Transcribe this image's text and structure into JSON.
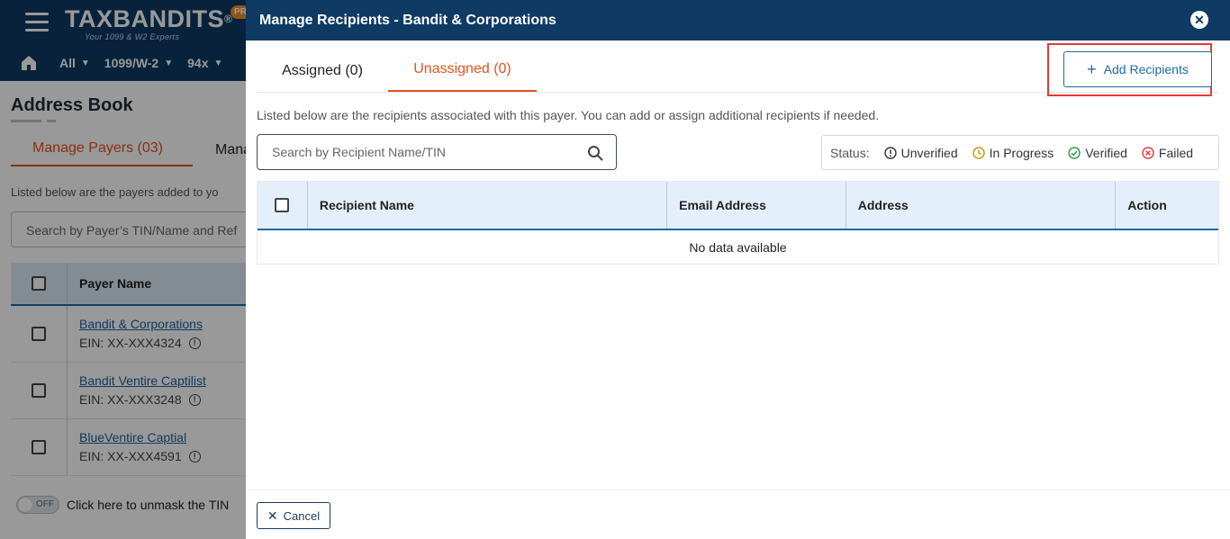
{
  "bg": {
    "logo_text": "TAXBANDITS",
    "logo_reg": "®",
    "logo_tagline": "Your 1099 & W2 Experts",
    "logo_badge": "PR",
    "nav": [
      "All",
      "1099/W-2",
      "94x"
    ],
    "title": "Address Book",
    "tab_payers": "Manage Payers (03)",
    "tab_other": "Mana",
    "description": "Listed below are the payers added to yo",
    "search_placeholder": "Search by Payer’s TIN/Name and Ref",
    "table_header": "Payer Name",
    "payers": [
      {
        "name": "Bandit & Corporations",
        "ein": "EIN: XX-XXX4324"
      },
      {
        "name": "Bandit Ventire Captilist",
        "ein": "EIN: XX-XXX3248"
      },
      {
        "name": "BlueVentire Captial",
        "ein": "EIN: XX-XXX4591"
      }
    ],
    "toggle_state": "OFF",
    "unmask_text": "Click here to unmask the TIN"
  },
  "modal": {
    "title": "Manage Recipients - Bandit & Corporations",
    "tabs": [
      {
        "label": "Assigned (0)",
        "active": false
      },
      {
        "label": "Unassigned (0)",
        "active": true
      }
    ],
    "add_button": "Add Recipients",
    "description": "Listed below are the recipients associated with this payer. You can add or assign additional recipients if needed.",
    "search_placeholder": "Search by Recipient Name/TIN",
    "status": {
      "label": "Status:",
      "items": [
        {
          "label": "Unverified",
          "icon": "exclamation-circle-icon",
          "color": "#333333"
        },
        {
          "label": "In Progress",
          "icon": "clock-icon",
          "color": "#c9920f"
        },
        {
          "label": "Verified",
          "icon": "check-circle-icon",
          "color": "#2e9e46"
        },
        {
          "label": "Failed",
          "icon": "x-circle-icon",
          "color": "#e53935"
        }
      ]
    },
    "table": {
      "columns": [
        "Recipient Name",
        "Email Address",
        "Address",
        "Action"
      ],
      "empty_text": "No data available"
    },
    "cancel_button": "Cancel"
  },
  "colors": {
    "header_bg": "#0e3a64",
    "accent_orange": "#e0541d",
    "primary_blue": "#1f6aa5",
    "highlight_red": "#e53935"
  }
}
